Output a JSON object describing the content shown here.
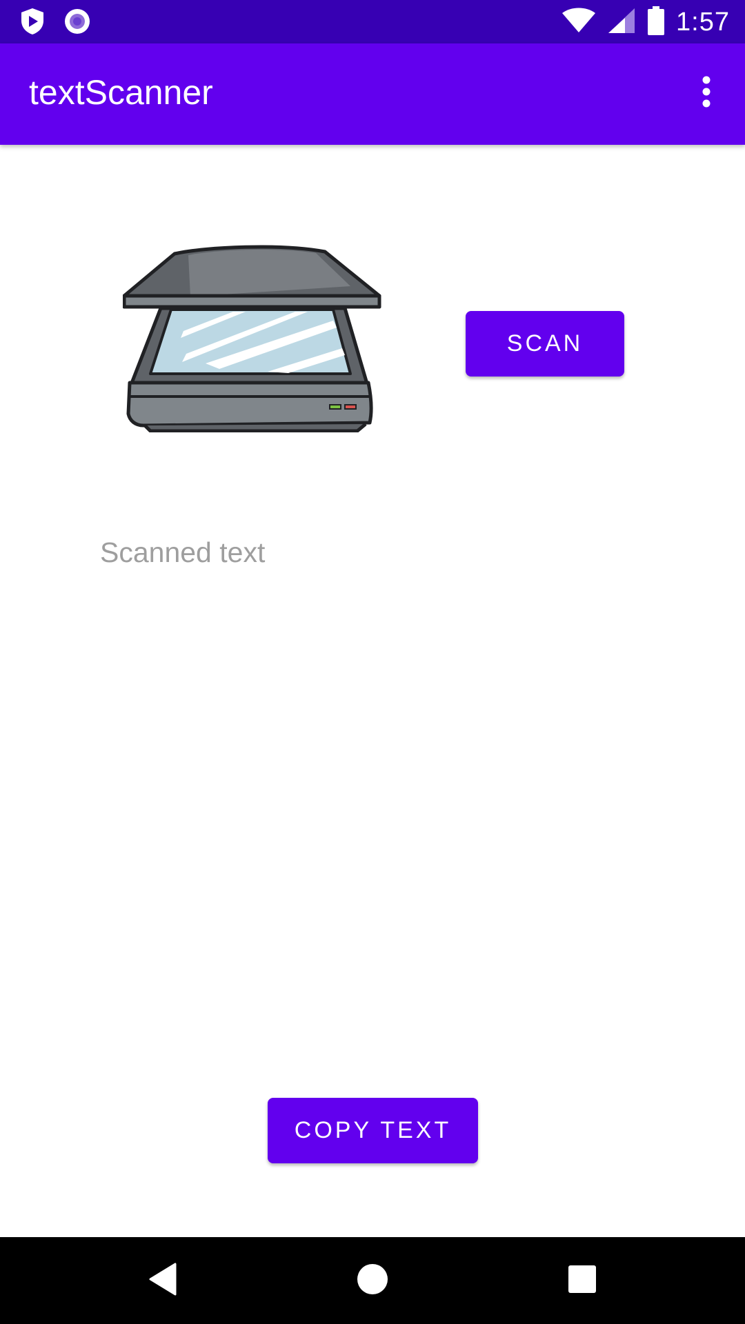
{
  "status_bar": {
    "time": "1:57",
    "icons": [
      "shield-play-icon",
      "radio-icon",
      "wifi-icon",
      "signal-icon",
      "battery-icon"
    ]
  },
  "app_bar": {
    "title": "textScanner",
    "menu_icon": "more-vert-icon"
  },
  "content": {
    "scan_label": "SCAN",
    "scanned_text_placeholder": "Scanned text",
    "copy_label": "COPY TEXT"
  },
  "nav_bar": {
    "icons": [
      "back-icon",
      "home-icon",
      "recents-icon"
    ]
  },
  "colors": {
    "status_bar": "#3700b3",
    "primary": "#6200ee",
    "placeholder_text": "#9e9e9e",
    "nav_bar": "#000000"
  }
}
